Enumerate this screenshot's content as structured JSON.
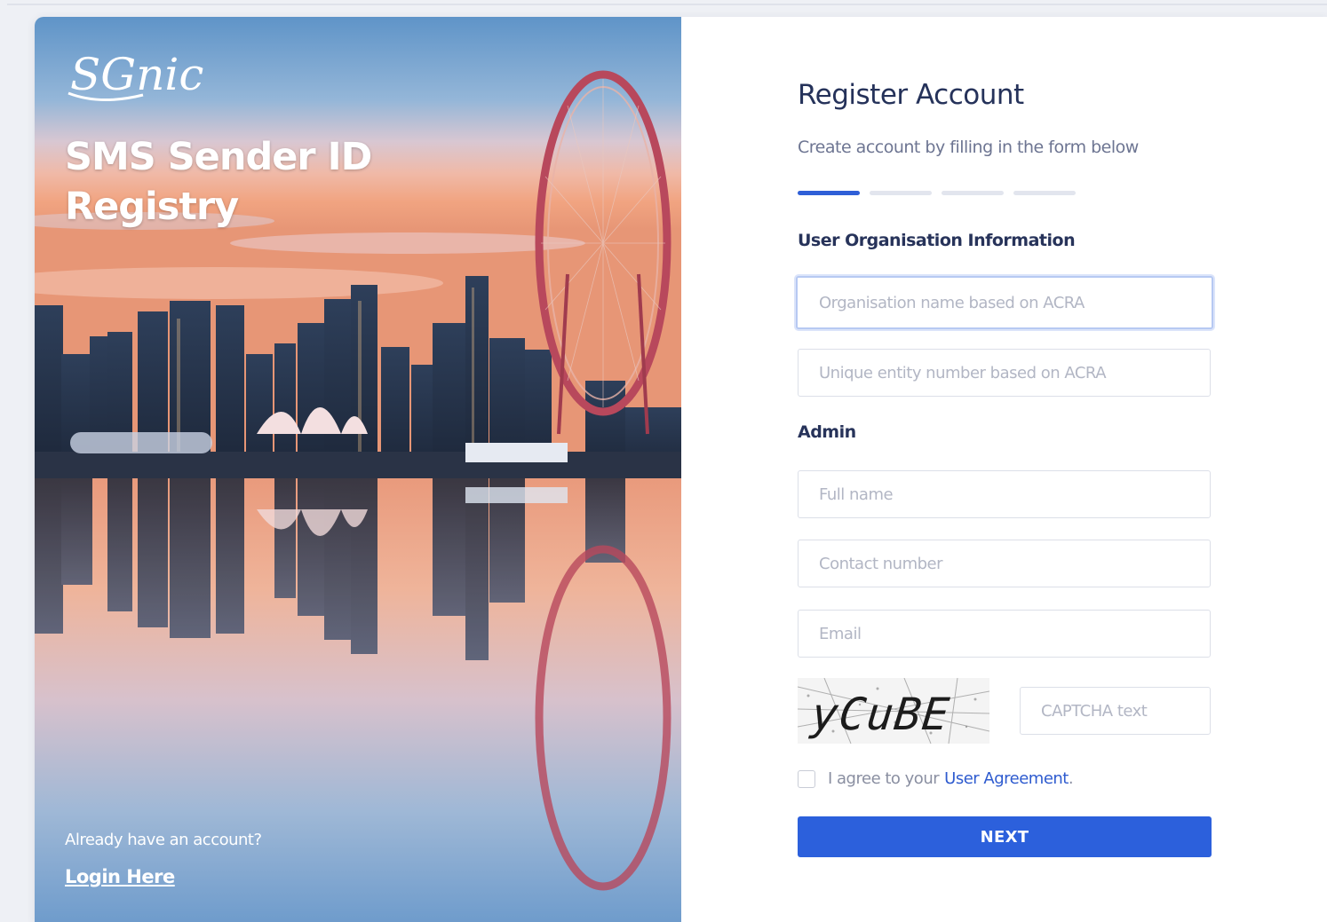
{
  "hero": {
    "logo_text": "SGnic",
    "title_line1": "SMS Sender ID",
    "title_line2": "Registry",
    "login_prompt": "Already have an account?",
    "login_link": "Login Here"
  },
  "form": {
    "title": "Register Account",
    "subtitle": "Create account by filling in the form below",
    "steps": {
      "total": 4,
      "active": 1
    },
    "org_section_label": "User Organisation Information",
    "org_name_placeholder": "Organisation name based on ACRA",
    "uen_placeholder": "Unique entity number based on ACRA",
    "admin_section_label": "Admin",
    "full_name_placeholder": "Full name",
    "contact_placeholder": "Contact number",
    "email_placeholder": "Email",
    "captcha_image_text": "yCuBE",
    "captcha_placeholder": "CAPTCHA text",
    "agree_text": "I agree to your",
    "agree_link": "User Agreement",
    "agree_suffix": ".",
    "next_label": "NEXT"
  },
  "colors": {
    "primary": "#2c60dc",
    "title": "#25325a",
    "muted": "#6d7592",
    "placeholder": "#b2b6c4"
  }
}
